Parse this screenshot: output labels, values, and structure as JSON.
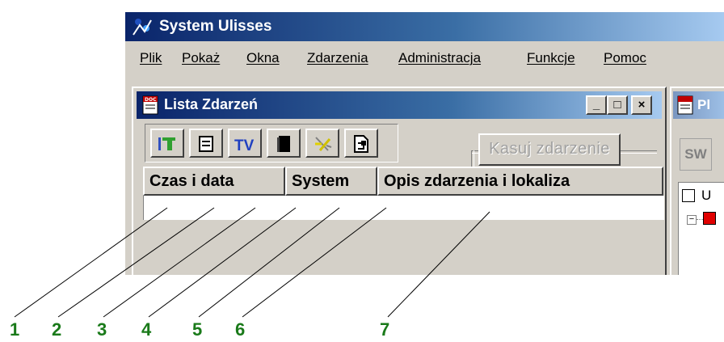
{
  "window": {
    "title": "System Ulisses"
  },
  "menu": [
    "Plik",
    "Pokaż",
    "Okna",
    "Zdarzenia",
    "Administracja",
    "Funkcje",
    "Pomoc"
  ],
  "child_window": {
    "title": "Lista Zdarzeń",
    "controls": {
      "minimize": "_",
      "maximize": "□",
      "close": "×"
    }
  },
  "toolbar_icons": [
    "filter-icon",
    "save-icon",
    "tv-icon",
    "book-icon",
    "flash-icon",
    "report-icon"
  ],
  "delete_button": {
    "label": "Kasuj zdarzenie",
    "enabled": false
  },
  "table": {
    "columns": [
      "Czas i data",
      "System",
      "Opis zdarzenia i lokaliza"
    ]
  },
  "side_window": {
    "title": "Pl",
    "button": "SW",
    "tree_root": "U"
  },
  "callouts": [
    "1",
    "2",
    "3",
    "4",
    "5",
    "6",
    "7"
  ],
  "colors": {
    "callout": "#1a7a1a",
    "titlebar": "#0a246a"
  }
}
